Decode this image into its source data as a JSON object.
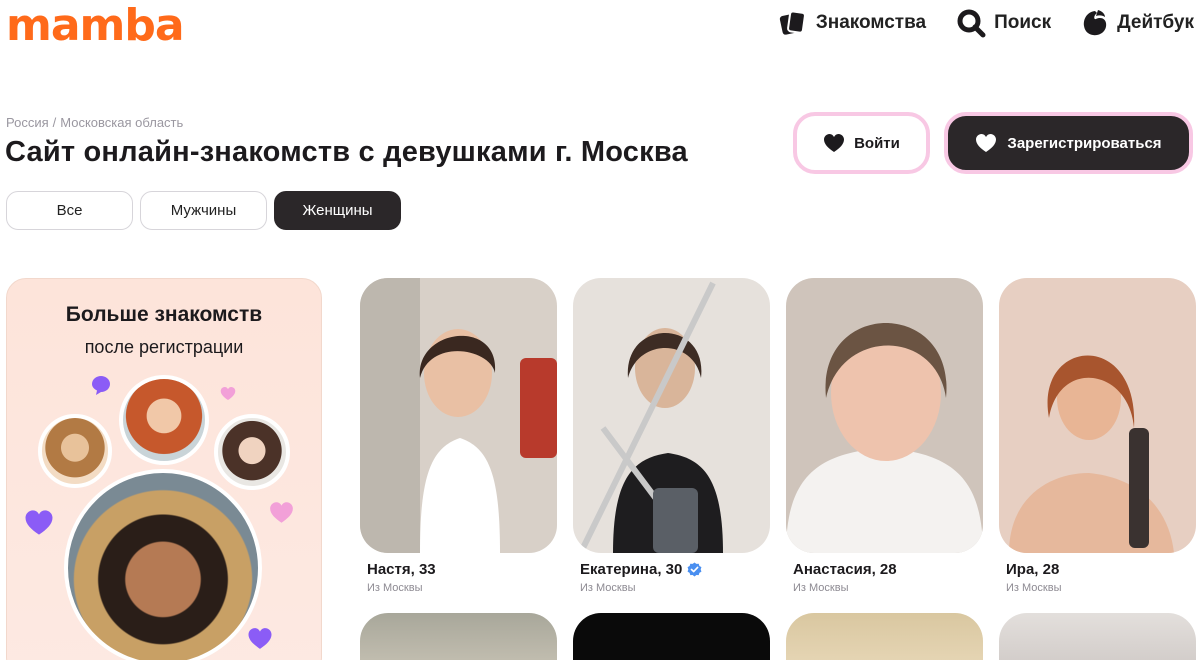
{
  "header": {
    "logo": "mamba",
    "nav": [
      {
        "label": "Знакомства",
        "icon": "cards-icon"
      },
      {
        "label": "Поиск",
        "icon": "search-icon"
      },
      {
        "label": "Дейтбук",
        "icon": "datebook-icon"
      }
    ]
  },
  "breadcrumb": {
    "country": "Россия",
    "separator": "/",
    "region": "Московская область"
  },
  "page_title": "Сайт онлайн-знакомств с девушками г. Москва",
  "filters": [
    {
      "label": "Все",
      "active": false
    },
    {
      "label": "Мужчины",
      "active": false
    },
    {
      "label": "Женщины",
      "active": true
    }
  ],
  "auth": {
    "login_label": "Войти",
    "register_label": "Зарегистрироваться"
  },
  "promo": {
    "title": "Больше знакомств",
    "subtitle": "после регистрации"
  },
  "profiles": [
    {
      "name": "Настя, 33",
      "city": "Из Москвы",
      "verified": false
    },
    {
      "name": "Екатерина, 30",
      "city": "Из Москвы",
      "verified": true
    },
    {
      "name": "Анастасия, 28",
      "city": "Из Москвы",
      "verified": false
    },
    {
      "name": "Ира, 28",
      "city": "Из Москвы",
      "verified": false
    }
  ],
  "colors": {
    "brand": "#ff6a1a",
    "dark": "#2b2729",
    "accent_pink": "#f8c8e4",
    "verified": "#4a8ff0",
    "promo_hearts": "#8b5cf6"
  }
}
